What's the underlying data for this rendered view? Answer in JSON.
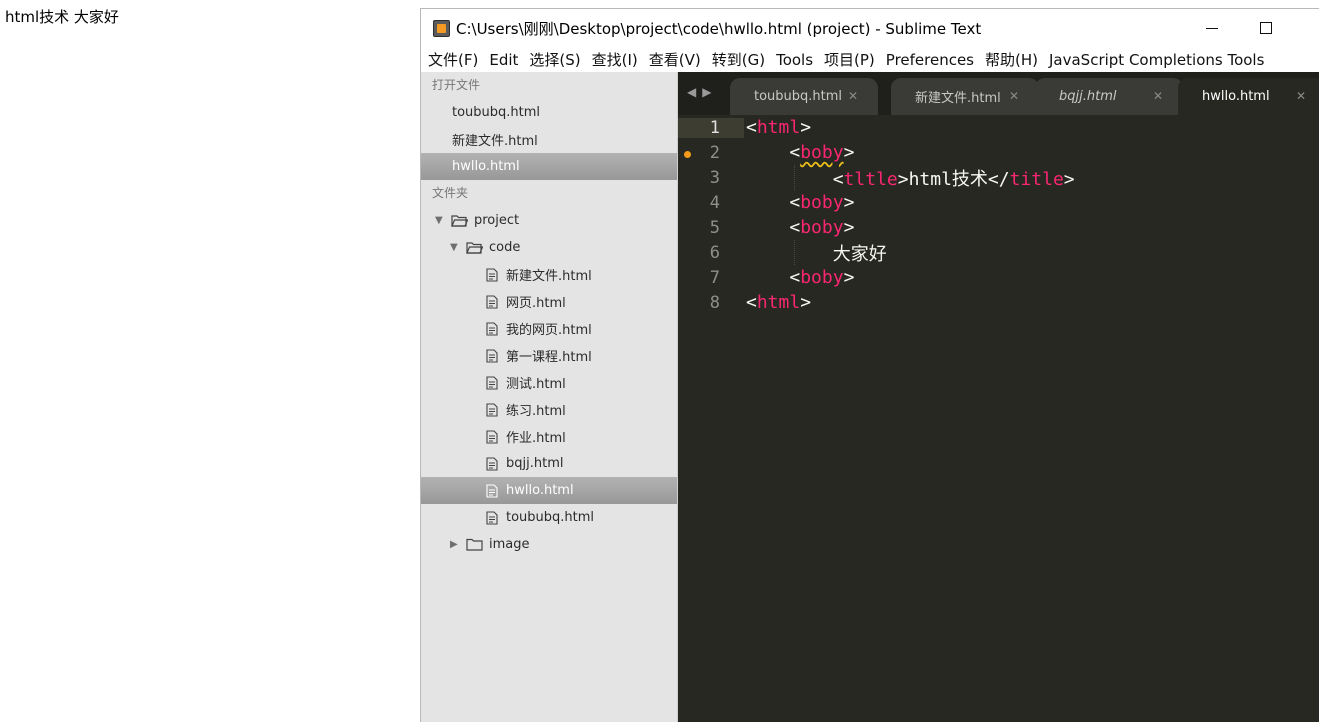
{
  "browser": {
    "text": "html技术 大家好"
  },
  "window": {
    "title": "C:\\Users\\刚刚\\Desktop\\project\\code\\hwllo.html (project) - Sublime Text"
  },
  "menu": [
    "文件(F)",
    "Edit",
    "选择(S)",
    "查找(I)",
    "查看(V)",
    "转到(G)",
    "Tools",
    "项目(P)",
    "Preferences",
    "帮助(H)",
    "JavaScript Completions Tools"
  ],
  "sidebar": {
    "open_files_header": "打开文件",
    "open_files": [
      "toububq.html",
      "新建文件.html",
      "hwllo.html"
    ],
    "folders_header": "文件夹",
    "project": "project",
    "code": "code",
    "files": [
      "新建文件.html",
      "网页.html",
      "我的网页.html",
      "第一课程.html",
      "测试.html",
      "练习.html",
      "作业.html",
      "bqjj.html",
      "hwllo.html",
      "toububq.html"
    ],
    "image": "image"
  },
  "tabs": [
    "toububq.html",
    "新建文件.html",
    "bqjj.html",
    "hwllo.html"
  ],
  "code": {
    "line_numbers": [
      "1",
      "2",
      "3",
      "4",
      "5",
      "6",
      "7",
      "8"
    ],
    "l1_open": "<",
    "l1_tag": "html",
    "l1_close": ">",
    "l2_open": "<",
    "l2_tag": "boby",
    "l2_close": ">",
    "l3_open": "<",
    "l3_tag": "tltle",
    "l3_mid": ">html技术</",
    "l3_tag2": "title",
    "l3_close": ">",
    "l4_open": "<",
    "l4_tag": "boby",
    "l4_close": ">",
    "l5_open": "<",
    "l5_tag": "boby",
    "l5_close": ">",
    "l6_text": "大家好",
    "l7_open": "<",
    "l7_tag": "boby",
    "l7_close": ">",
    "l8_open": "<",
    "l8_tag": "html",
    "l8_close": ">"
  },
  "colors": {
    "editor_bg": "#272822",
    "tag": "#f92672",
    "text": "#f8f8f2",
    "modified_dot": "#f49a1a"
  }
}
